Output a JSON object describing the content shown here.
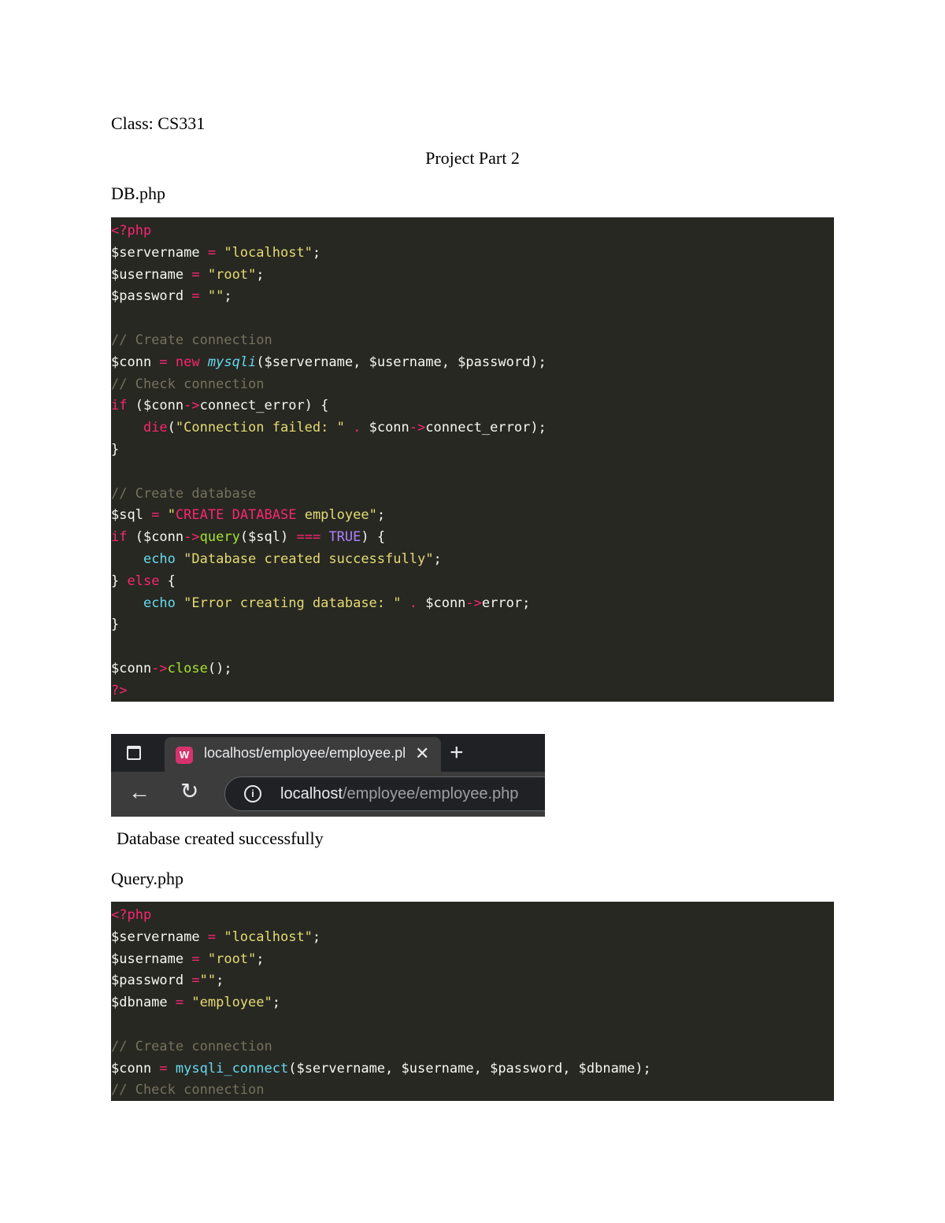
{
  "class_line": "Class: CS331",
  "title": "Project Part 2",
  "db_heading": "DB.php",
  "query_heading": "Query.php",
  "output_text": "Database created successfully",
  "browser": {
    "tab_title": "localhost/employee/employee.pl",
    "close_glyph": "✕",
    "newtab_glyph": "+",
    "back_glyph": "←",
    "reload_glyph": "↻",
    "info_glyph": "i",
    "url_host": "localhost",
    "url_path": "/employee/employee.php",
    "icons": [
      "tab-actions-icon",
      "favicon-icon",
      "close-icon",
      "new-tab-icon",
      "back-icon",
      "reload-icon",
      "info-icon"
    ]
  },
  "code_colors": {
    "background": "#272822",
    "keyword": "#f92672",
    "string": "#e6db74",
    "comment": "#75715e",
    "function": "#a6e22e",
    "builtin": "#66d9ef",
    "constant": "#ae81ff",
    "text": "#f8f8f2"
  },
  "db_code": [
    [
      [
        "kw",
        "<?php"
      ]
    ],
    [
      [
        "t",
        "$servername "
      ],
      [
        "kw",
        "="
      ],
      [
        "t",
        " "
      ],
      [
        "str",
        "\"localhost\""
      ],
      [
        "t",
        ";"
      ]
    ],
    [
      [
        "t",
        "$username "
      ],
      [
        "kw",
        "="
      ],
      [
        "t",
        " "
      ],
      [
        "str",
        "\"root\""
      ],
      [
        "t",
        ";"
      ]
    ],
    [
      [
        "t",
        "$password "
      ],
      [
        "kw",
        "="
      ],
      [
        "t",
        " "
      ],
      [
        "str",
        "\"\""
      ],
      [
        "t",
        ";"
      ]
    ],
    [],
    [
      [
        "cm",
        "// Create connection"
      ]
    ],
    [
      [
        "t",
        "$conn "
      ],
      [
        "kw",
        "="
      ],
      [
        "t",
        " "
      ],
      [
        "kw",
        "new"
      ],
      [
        "t",
        " "
      ],
      [
        "fn",
        "mysqli"
      ],
      [
        "t",
        "($servername, $username, $password);"
      ]
    ],
    [
      [
        "cm",
        "// Check connection"
      ]
    ],
    [
      [
        "kw",
        "if"
      ],
      [
        "t",
        " ($conn"
      ],
      [
        "kw",
        "->"
      ],
      [
        "t",
        "connect_error) {"
      ]
    ],
    [
      [
        "t",
        "    "
      ],
      [
        "kw",
        "die"
      ],
      [
        "t",
        "("
      ],
      [
        "str",
        "\"Connection failed: \""
      ],
      [
        "t",
        " "
      ],
      [
        "kw",
        "."
      ],
      [
        "t",
        " $conn"
      ],
      [
        "kw",
        "->"
      ],
      [
        "t",
        "connect_error);"
      ]
    ],
    [
      [
        "t",
        "}"
      ]
    ],
    [],
    [
      [
        "cm",
        "// Create database"
      ]
    ],
    [
      [
        "t",
        "$sql "
      ],
      [
        "kw",
        "="
      ],
      [
        "t",
        " "
      ],
      [
        "str",
        "\""
      ],
      [
        "kw",
        "CREATE DATABASE"
      ],
      [
        "str",
        " employee\""
      ],
      [
        "t",
        ";"
      ]
    ],
    [
      [
        "kw",
        "if"
      ],
      [
        "t",
        " ($conn"
      ],
      [
        "kw",
        "->"
      ],
      [
        "fnc",
        "query"
      ],
      [
        "t",
        "($sql) "
      ],
      [
        "kw",
        "==="
      ],
      [
        "t",
        " "
      ],
      [
        "cst",
        "TRUE"
      ],
      [
        "t",
        ") {"
      ]
    ],
    [
      [
        "t",
        "    "
      ],
      [
        "ech",
        "echo"
      ],
      [
        "t",
        " "
      ],
      [
        "str",
        "\"Database created successfully\""
      ],
      [
        "t",
        ";"
      ]
    ],
    [
      [
        "t",
        "} "
      ],
      [
        "kw",
        "else"
      ],
      [
        "t",
        " {"
      ]
    ],
    [
      [
        "t",
        "    "
      ],
      [
        "ech",
        "echo"
      ],
      [
        "t",
        " "
      ],
      [
        "str",
        "\"Error creating database: \""
      ],
      [
        "t",
        " "
      ],
      [
        "kw",
        "."
      ],
      [
        "t",
        " $conn"
      ],
      [
        "kw",
        "->"
      ],
      [
        "t",
        "error;"
      ]
    ],
    [
      [
        "t",
        "}"
      ]
    ],
    [],
    [
      [
        "t",
        "$conn"
      ],
      [
        "kw",
        "->"
      ],
      [
        "fnc",
        "close"
      ],
      [
        "t",
        "();"
      ]
    ],
    [
      [
        "kw",
        "?>"
      ]
    ]
  ],
  "query_code": [
    [
      [
        "kw",
        "<?php"
      ]
    ],
    [
      [
        "t",
        "$servername "
      ],
      [
        "kw",
        "="
      ],
      [
        "t",
        " "
      ],
      [
        "str",
        "\"localhost\""
      ],
      [
        "t",
        ";"
      ]
    ],
    [
      [
        "t",
        "$username "
      ],
      [
        "kw",
        "="
      ],
      [
        "t",
        " "
      ],
      [
        "str",
        "\"root\""
      ],
      [
        "t",
        ";"
      ]
    ],
    [
      [
        "t",
        "$password "
      ],
      [
        "kw",
        "="
      ],
      [
        "str",
        "\"\""
      ],
      [
        "t",
        ";"
      ]
    ],
    [
      [
        "t",
        "$dbname "
      ],
      [
        "kw",
        "="
      ],
      [
        "t",
        " "
      ],
      [
        "str",
        "\"employee\""
      ],
      [
        "t",
        ";"
      ]
    ],
    [],
    [
      [
        "cm",
        "// Create connection"
      ]
    ],
    [
      [
        "t",
        "$conn "
      ],
      [
        "kw",
        "="
      ],
      [
        "t",
        " "
      ],
      [
        "ech",
        "mysqli_connect"
      ],
      [
        "t",
        "($servername, $username, $password, $dbname);"
      ]
    ],
    [
      [
        "cm",
        "// Check connection"
      ]
    ]
  ]
}
